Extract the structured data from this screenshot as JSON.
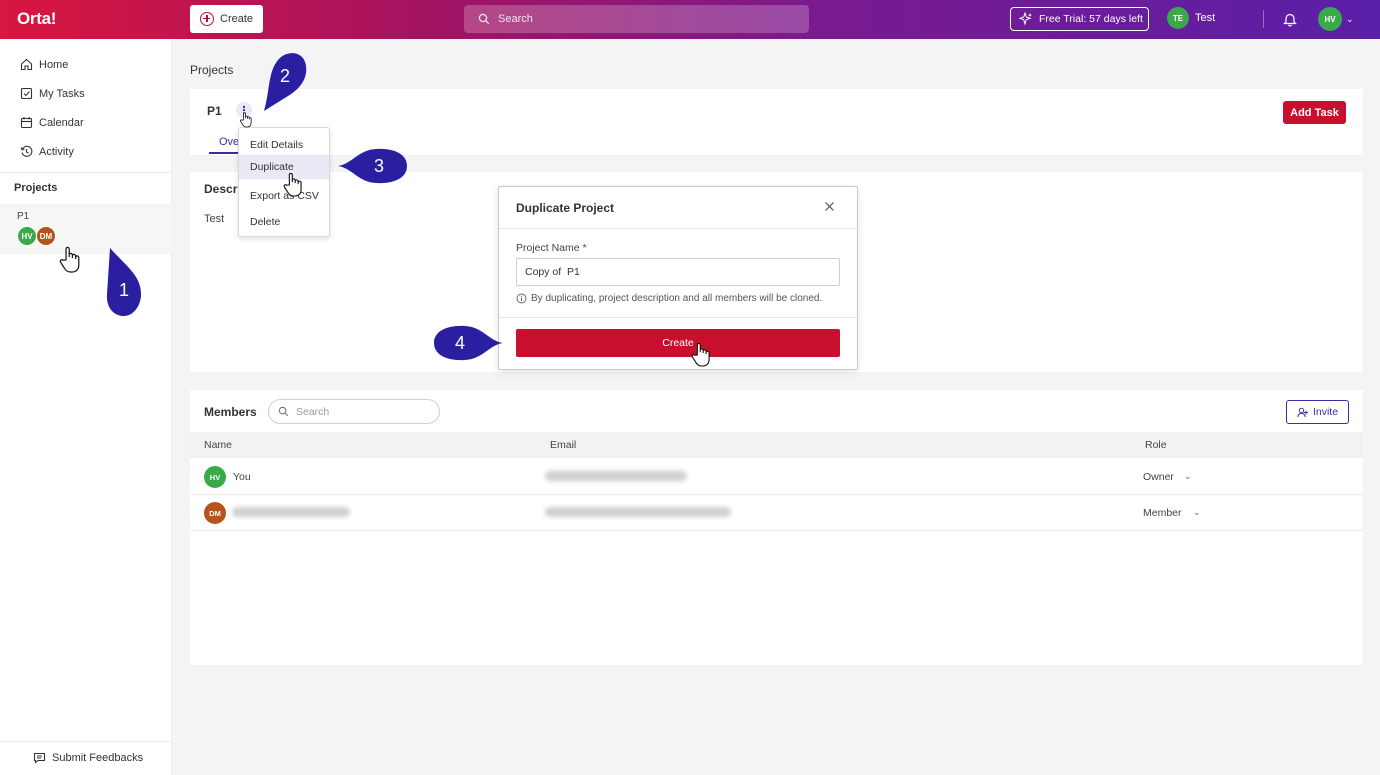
{
  "app": {
    "logo": "Orta!",
    "create_label": "Create",
    "search_placeholder": "Search",
    "trial_label": "Free Trial: 57 days left",
    "workspace_initials": "TE",
    "workspace_name": "Test",
    "user_initials": "HV"
  },
  "sidebar": {
    "nav": [
      {
        "label": "Home",
        "icon": "home-icon"
      },
      {
        "label": "My Tasks",
        "icon": "checkbox-icon"
      },
      {
        "label": "Calendar",
        "icon": "calendar-icon"
      },
      {
        "label": "Activity",
        "icon": "history-icon"
      }
    ],
    "projects_heading": "Projects",
    "project": {
      "name": "P1",
      "avatars": [
        "HV",
        "DM"
      ]
    },
    "feedback_label": "Submit Feedbacks"
  },
  "page": {
    "heading": "Projects",
    "project_title": "P1",
    "kebab": "⋮",
    "add_task_label": "Add Task",
    "tab_overview": "Ove",
    "description_heading": "Descri",
    "description_text": "Test"
  },
  "menu": {
    "items": [
      "Edit Details",
      "Duplicate",
      "Export as CSV",
      "Delete"
    ]
  },
  "modal": {
    "title": "Duplicate Project",
    "field_label": "Project Name",
    "required_mark": "*",
    "field_value": "Copy of  P1",
    "hint": "By duplicating, project description and all members will be cloned.",
    "create_label": "Create"
  },
  "members": {
    "heading": "Members",
    "search_placeholder": "Search",
    "invite_label": "Invite",
    "columns": [
      "Name",
      "Email",
      "Role"
    ],
    "rows": [
      {
        "initials": "HV",
        "name": "You",
        "role": "Owner",
        "color": "#3aa94a"
      },
      {
        "initials": "DM",
        "name": "",
        "role": "Member",
        "color": "#b5541a"
      }
    ]
  },
  "annotations": [
    "1",
    "2",
    "3",
    "4"
  ],
  "colors": {
    "brand": "#c8102e",
    "accent": "#3b2ca3",
    "annotation": "#2a1fa0"
  }
}
